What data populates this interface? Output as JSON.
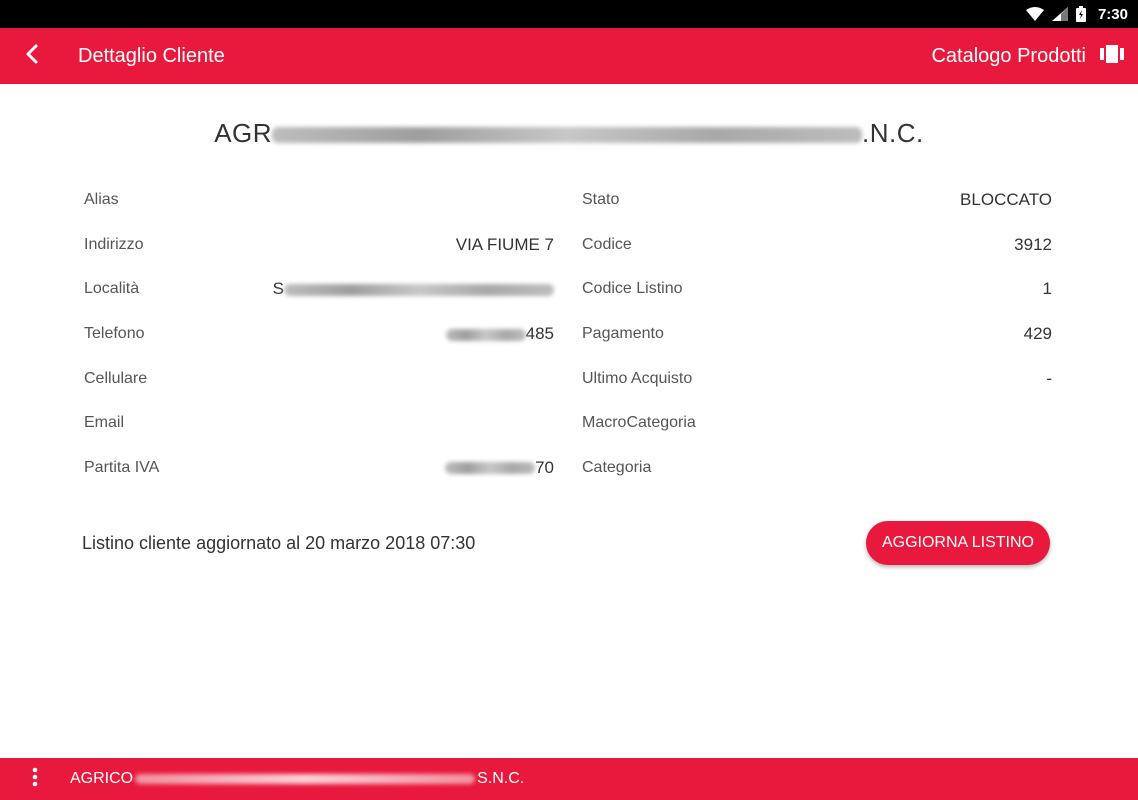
{
  "status_bar": {
    "time": "7:30",
    "icons": [
      "wifi-icon",
      "signal-icon",
      "battery-icon"
    ]
  },
  "app_bar": {
    "title": "Dettaglio Cliente",
    "back_icon": "chevron-left-icon",
    "catalog_label": "Catalogo Prodotti",
    "catalog_icon": "carousel-icon"
  },
  "client": {
    "name_prefix": "AGR",
    "name_suffix": ".N.C."
  },
  "details": {
    "left": [
      {
        "label": "Alias",
        "value": ""
      },
      {
        "label": "Indirizzo",
        "value": "VIA FIUME 7"
      },
      {
        "label": "Località",
        "value_prefix": "S",
        "value_suffix": ""
      },
      {
        "label": "Telefono",
        "value_prefix": "",
        "value_suffix": "485"
      },
      {
        "label": "Cellulare",
        "value": ""
      },
      {
        "label": "Email",
        "value": ""
      },
      {
        "label": "Partita IVA",
        "value_prefix": "",
        "value_suffix": "70"
      }
    ],
    "right": [
      {
        "label": "Stato",
        "value": "BLOCCATO"
      },
      {
        "label": "Codice",
        "value": "3912"
      },
      {
        "label": "Codice Listino",
        "value": "1"
      },
      {
        "label": "Pagamento",
        "value": "429"
      },
      {
        "label": "Ultimo Acquisto",
        "value": "-"
      },
      {
        "label": "MacroCategoria",
        "value": ""
      },
      {
        "label": "Categoria",
        "value": ""
      }
    ]
  },
  "update": {
    "text": "Listino cliente aggiornato al 20 marzo 2018 07:30",
    "button_label": "AGGIORNA LISTINO"
  },
  "bottom_bar": {
    "menu_icon": "more-vertical-icon",
    "name_prefix": "AGRICO",
    "name_suffix": "S.N.C."
  },
  "colors": {
    "accent": "#e8193c",
    "status_bar": "#000000",
    "text": "#333333"
  }
}
